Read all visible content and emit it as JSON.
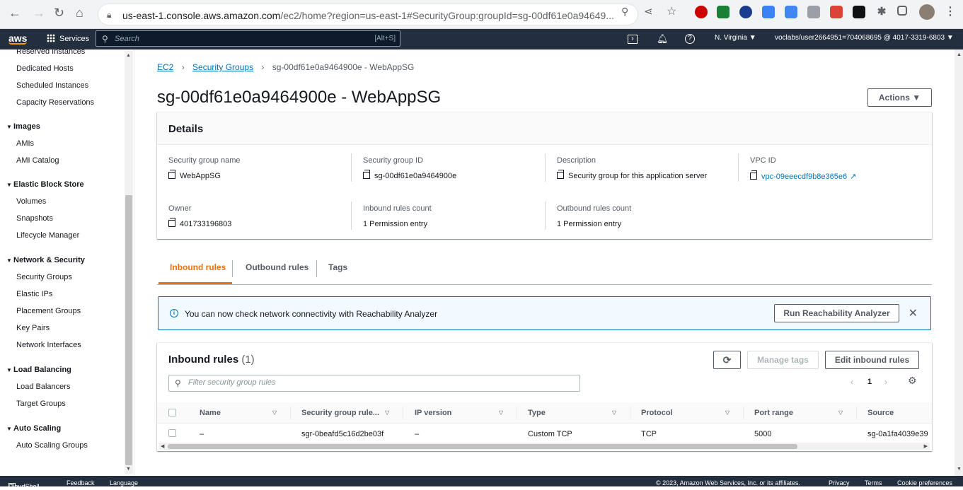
{
  "browser": {
    "url_host": "us-east-1.console.aws.amazon.com",
    "url_path": "/ec2/home?region=us-east-1#SecurityGroup:groupId=sg-00df61e0a94649..."
  },
  "topnav": {
    "logo": "aws",
    "services": "Services",
    "search_placeholder": "Search",
    "search_shortcut": "[Alt+S]",
    "region": "N. Virginia ▼",
    "account": "voclabs/user2664951=704068695 @ 4017-3319-6803 ▼"
  },
  "sidebar": {
    "items": [
      {
        "label": "Reserved Instances"
      },
      {
        "label": "Dedicated Hosts"
      },
      {
        "label": "Scheduled Instances"
      },
      {
        "label": "Capacity Reservations"
      }
    ],
    "images": {
      "title": "Images",
      "items": [
        "AMIs",
        "AMI Catalog"
      ]
    },
    "ebs": {
      "title": "Elastic Block Store",
      "items": [
        "Volumes",
        "Snapshots",
        "Lifecycle Manager"
      ]
    },
    "network": {
      "title": "Network & Security",
      "items": [
        "Security Groups",
        "Elastic IPs",
        "Placement Groups",
        "Key Pairs",
        "Network Interfaces"
      ]
    },
    "lb": {
      "title": "Load Balancing",
      "items": [
        "Load Balancers",
        "Target Groups"
      ]
    },
    "as": {
      "title": "Auto Scaling",
      "items": [
        "Auto Scaling Groups"
      ]
    }
  },
  "breadcrumb": {
    "ec2": "EC2",
    "sg": "Security Groups",
    "current": "sg-00df61e0a9464900e - WebAppSG"
  },
  "page": {
    "title": "sg-00df61e0a9464900e - WebAppSG",
    "actions": "Actions ▼"
  },
  "details": {
    "header": "Details",
    "sg_name_label": "Security group name",
    "sg_name": "WebAppSG",
    "sg_id_label": "Security group ID",
    "sg_id": "sg-00df61e0a9464900e",
    "desc_label": "Description",
    "desc": "Security group for this application server",
    "vpc_label": "VPC ID",
    "vpc": "vpc-09eeecdf9b8e365e6",
    "owner_label": "Owner",
    "owner": "401733196803",
    "in_count_label": "Inbound rules count",
    "in_count": "1 Permission entry",
    "out_count_label": "Outbound rules count",
    "out_count": "1 Permission entry"
  },
  "tabs": {
    "inbound": "Inbound rules",
    "outbound": "Outbound rules",
    "tags": "Tags"
  },
  "flash": {
    "message": "You can now check network connectivity with Reachability Analyzer",
    "button": "Run Reachability Analyzer"
  },
  "inbound": {
    "title": "Inbound rules",
    "count": "(1)",
    "manage_tags": "Manage tags",
    "edit": "Edit inbound rules",
    "filter_placeholder": "Filter security group rules",
    "page": "1",
    "columns": [
      "Name",
      "Security group rule...",
      "IP version",
      "Type",
      "Protocol",
      "Port range",
      "Source"
    ],
    "row": [
      "–",
      "sgr-0beafd5c16d2be03f",
      "–",
      "Custom TCP",
      "TCP",
      "5000",
      "sg-0a1fa4039e39"
    ]
  },
  "footer": {
    "cloudshell": "CloudShell",
    "feedback": "Feedback",
    "language": "Language",
    "copyright": "© 2023, Amazon Web Services, Inc. or its affiliates.",
    "privacy": "Privacy",
    "terms": "Terms",
    "cookies": "Cookie preferences"
  },
  "colors": {
    "aws_orange": "#ff9900",
    "link": "#0073bb",
    "active_tab": "#ec7211",
    "nav_bg": "#232f3e"
  }
}
